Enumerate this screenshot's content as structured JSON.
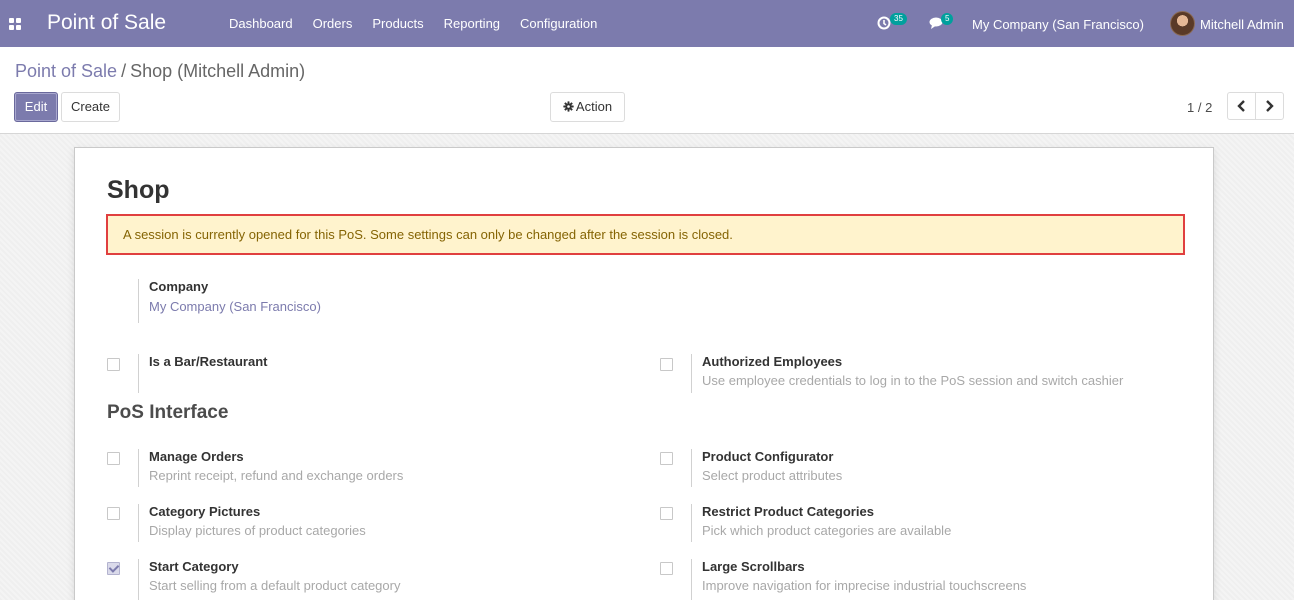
{
  "navbar": {
    "app_title": "Point of Sale",
    "menu": [
      "Dashboard",
      "Orders",
      "Products",
      "Reporting",
      "Configuration"
    ],
    "activity_count": "35",
    "message_count": "5",
    "company": "My Company (San Francisco)",
    "user": "Mitchell Admin",
    "icons": [
      "apps-icon",
      "clock-icon",
      "chat-icon"
    ]
  },
  "breadcrumb": {
    "parent": "Point of Sale",
    "separator": "/",
    "current": "Shop (Mitchell Admin)"
  },
  "toolbar": {
    "edit_label": "Edit",
    "create_label": "Create",
    "action_label": "Action"
  },
  "pager": {
    "value": "1 / 2"
  },
  "record": {
    "title": "Shop",
    "alert": "A session is currently opened for this PoS. Some settings can only be changed after the session is closed.",
    "company_label": "Company",
    "company_value": "My Company (San Francisco)",
    "top_settings": [
      {
        "label": "Is a Bar/Restaurant",
        "help": "",
        "checked": false
      },
      {
        "label": "Authorized Employees",
        "help": "Use employee credentials to log in to the PoS session and switch cashier",
        "checked": false
      }
    ],
    "section_title": "PoS Interface",
    "settings": [
      {
        "label": "Manage Orders",
        "help": "Reprint receipt, refund and exchange orders",
        "checked": false
      },
      {
        "label": "Product Configurator",
        "help": "Select product attributes",
        "checked": false
      },
      {
        "label": "Category Pictures",
        "help": "Display pictures of product categories",
        "checked": false
      },
      {
        "label": "Restrict Product Categories",
        "help": "Pick which product categories are available",
        "checked": false
      },
      {
        "label": "Start Category",
        "help": "Start selling from a default product category",
        "checked": true
      },
      {
        "label": "Large Scrollbars",
        "help": "Improve navigation for imprecise industrial touchscreens",
        "checked": false
      }
    ]
  },
  "colors": {
    "brand": "#7c7bad",
    "badge": "#00a09d",
    "alert_bg": "#fff3cd",
    "alert_border": "#e03f3f",
    "alert_text": "#856404"
  }
}
